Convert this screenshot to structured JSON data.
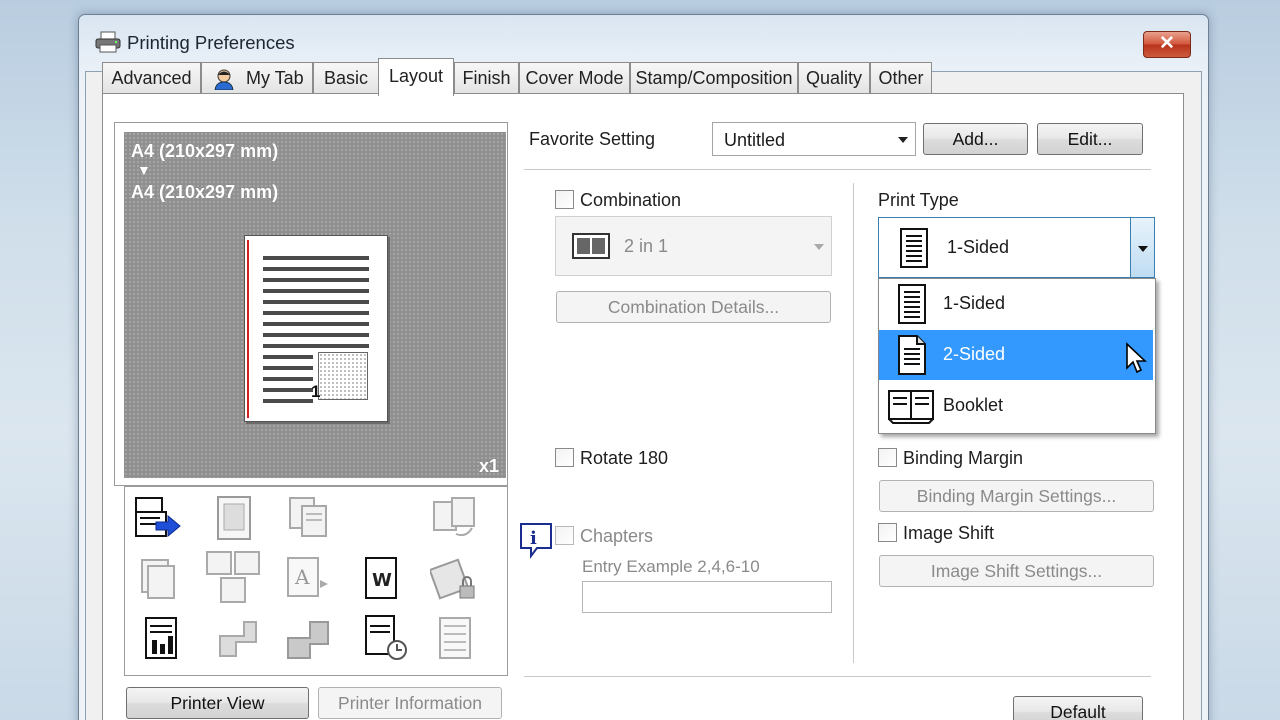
{
  "window": {
    "title": "Printing Preferences",
    "close_glyph": "✕"
  },
  "tabs": [
    {
      "label": "Advanced",
      "active": false
    },
    {
      "label": "My Tab",
      "active": false
    },
    {
      "label": "Basic",
      "active": false
    },
    {
      "label": "Layout",
      "active": true
    },
    {
      "label": "Finish",
      "active": false
    },
    {
      "label": "Cover Mode",
      "active": false
    },
    {
      "label": "Stamp/Composition",
      "active": false
    },
    {
      "label": "Quality",
      "active": false
    },
    {
      "label": "Other",
      "active": false
    }
  ],
  "preview": {
    "original_size": "A4 (210x297 mm)",
    "arrow": "▼",
    "output_size": "A4 (210x297 mm)",
    "page_number": "1",
    "copies": "x1"
  },
  "bottom_left_buttons": {
    "printer_view": "Printer View",
    "printer_information": "Printer Information"
  },
  "favorite": {
    "label": "Favorite Setting",
    "value": "Untitled",
    "add": "Add...",
    "edit": "Edit..."
  },
  "combination": {
    "label": "Combination",
    "value": "2 in 1",
    "details_button": "Combination Details..."
  },
  "rotate": {
    "label": "Rotate 180"
  },
  "chapters": {
    "label": "Chapters",
    "entry_hint": "Entry Example 2,4,6-10",
    "value": ""
  },
  "print_type": {
    "label": "Print Type",
    "value": "1-Sided",
    "options": [
      {
        "label": "1-Sided",
        "icon": "one-sided-page-icon",
        "selected": false
      },
      {
        "label": "2-Sided",
        "icon": "two-sided-page-icon",
        "selected": true
      },
      {
        "label": "Booklet",
        "icon": "booklet-icon",
        "selected": false
      }
    ]
  },
  "binding_margin": {
    "label": "Binding Margin",
    "settings_button": "Binding Margin Settings..."
  },
  "image_shift": {
    "label": "Image Shift",
    "settings_button": "Image Shift Settings..."
  },
  "default_button": "Default",
  "colors": {
    "selection": "#3399ff",
    "close_button": "#c8452b",
    "preview_background": "#909090",
    "binding_red_line": "#cc2222"
  }
}
